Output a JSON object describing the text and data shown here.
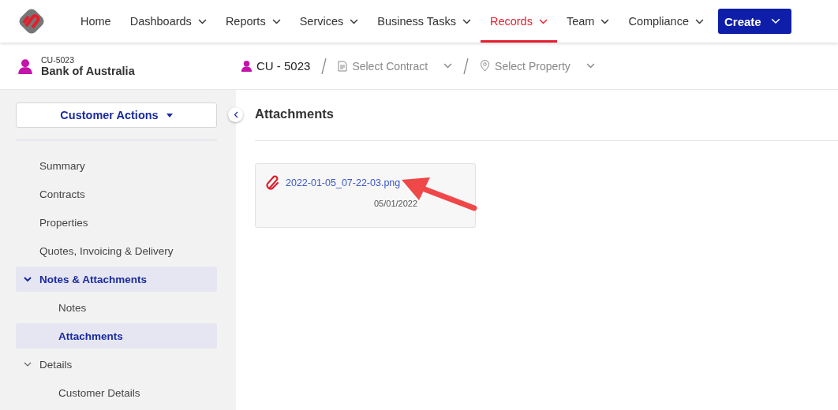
{
  "nav": {
    "items": [
      {
        "label": "Home",
        "selected": false,
        "dropdown": false
      },
      {
        "label": "Dashboards",
        "selected": false,
        "dropdown": true
      },
      {
        "label": "Reports",
        "selected": false,
        "dropdown": true
      },
      {
        "label": "Services",
        "selected": false,
        "dropdown": true
      },
      {
        "label": "Business Tasks",
        "selected": false,
        "dropdown": true
      },
      {
        "label": "Records",
        "selected": true,
        "dropdown": true
      },
      {
        "label": "Team",
        "selected": false,
        "dropdown": true
      },
      {
        "label": "Compliance",
        "selected": false,
        "dropdown": true
      }
    ],
    "create_button": "Create"
  },
  "header": {
    "customer_code": "CU-5023",
    "customer_name": "Bank of Australia",
    "breadcrumb": [
      {
        "kind": "record",
        "label": "CU - 5023"
      },
      {
        "kind": "contract",
        "label": "Select Contract"
      },
      {
        "kind": "property",
        "label": "Select Property"
      }
    ]
  },
  "sidebar": {
    "actions_button": "Customer Actions",
    "items": [
      {
        "label": "Summary",
        "selected": false
      },
      {
        "label": "Contracts",
        "selected": false
      },
      {
        "label": "Properties",
        "selected": false
      },
      {
        "label": "Quotes, Invoicing & Delivery",
        "selected": false
      },
      {
        "label": "Notes & Attachments",
        "selected": true,
        "expanded": true,
        "children": [
          {
            "label": "Notes",
            "selected": false
          },
          {
            "label": "Attachments",
            "selected": true
          }
        ]
      },
      {
        "label": "Details",
        "selected": false,
        "expanded": true,
        "children": [
          {
            "label": "Customer Details",
            "selected": false
          }
        ]
      }
    ]
  },
  "main": {
    "title": "Attachments",
    "attachments": [
      {
        "filename": "2022-01-05_07-22-03.png",
        "date": "05/01/2022"
      }
    ]
  }
}
